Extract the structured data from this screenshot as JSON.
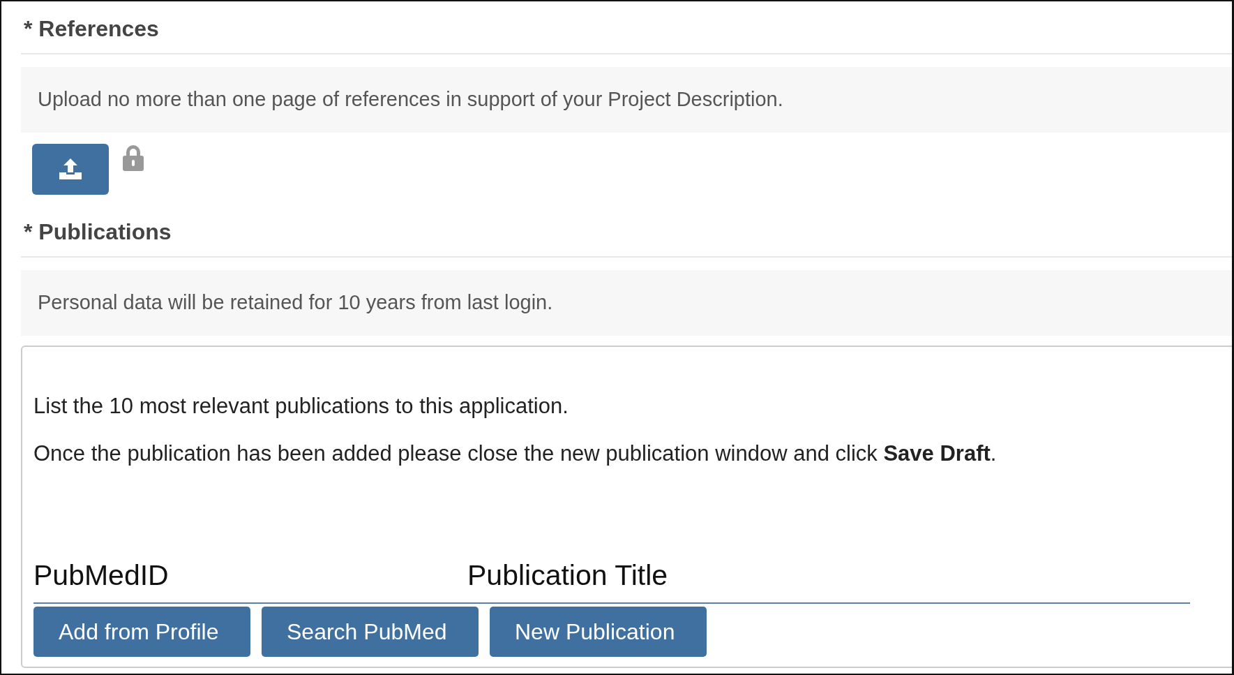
{
  "references": {
    "title": "* References",
    "note": "Upload no more than one page of references in support of your Project Description.",
    "upload": {
      "locked": true
    }
  },
  "publications": {
    "title": "* Publications",
    "note": "Personal data will be retained for 10 years from last login.",
    "instructions": [
      "List the 10 most relevant publications to this application.",
      "Once the publication has been added please close the new publication window and click **Save Draft**."
    ],
    "columns": [
      "PubMedID",
      "Publication Title"
    ],
    "buttons": [
      "Add from Profile",
      "Search PubMed",
      "New Publication"
    ]
  }
}
